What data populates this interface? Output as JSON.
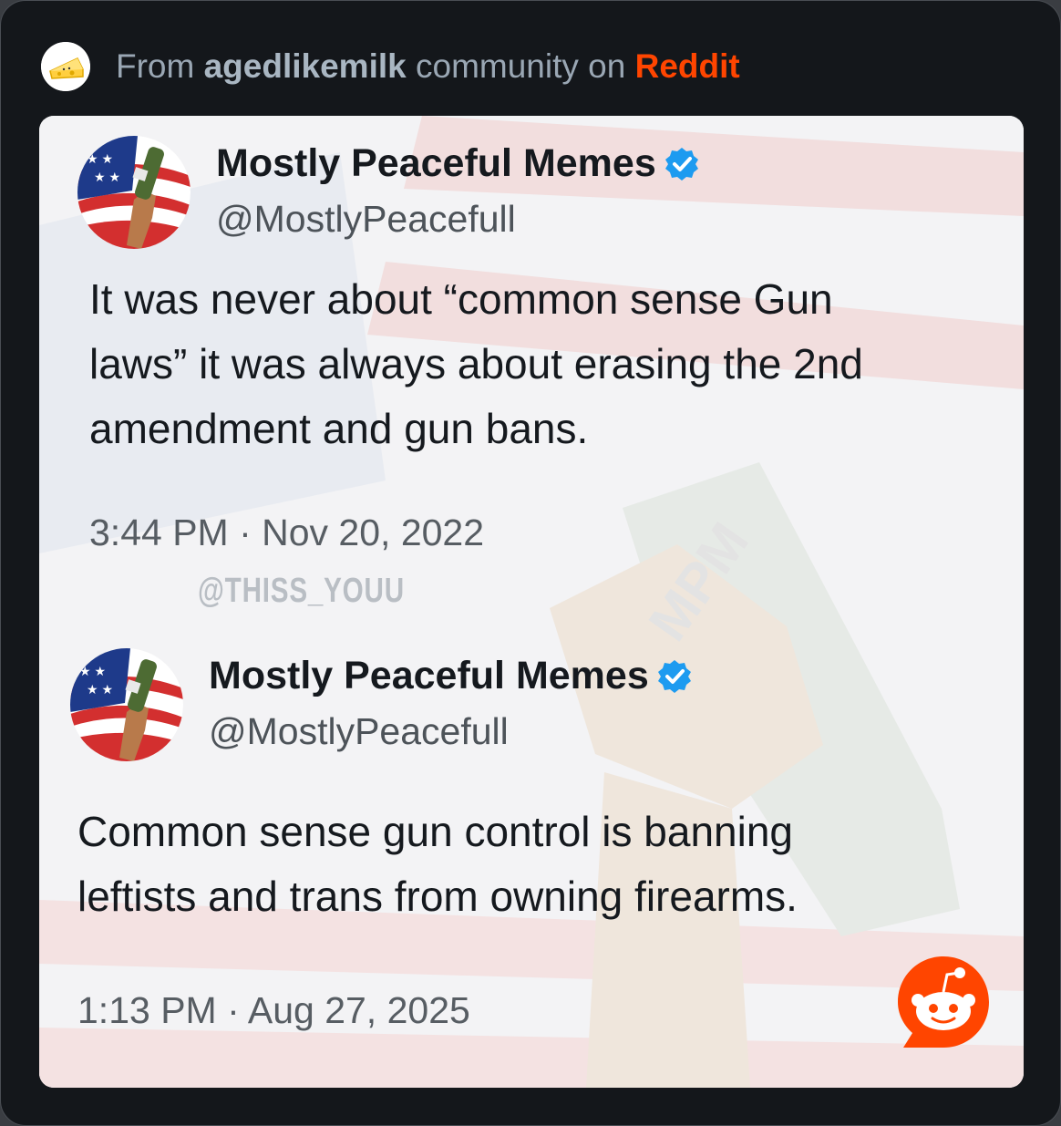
{
  "header": {
    "prefix": "From",
    "community": "agedlikemilk",
    "middle": "community on",
    "platform": "Reddit"
  },
  "tweets": [
    {
      "display_name": "Mostly Peaceful Memes",
      "handle": "@MostlyPeacefull",
      "text_lines": [
        "It was never about “common sense Gun",
        "laws” it was always about erasing the 2nd",
        "amendment and gun bans."
      ],
      "timestamp": "3:44 PM · Nov 20, 2022"
    },
    {
      "display_name": "Mostly Peaceful Memes",
      "handle": "@MostlyPeacefull",
      "text_lines": [
        "Common sense gun control is banning",
        "leftists and trans from owning firearms."
      ],
      "timestamp": "1:13 PM · Aug 27, 2025"
    }
  ],
  "watermark": "@THISS_YOUU",
  "colors": {
    "reddit_orange": "#ff4500",
    "verified_blue": "#1d9bf0"
  },
  "icons": [
    "cheese-avatar-icon",
    "verified-badge-icon",
    "reddit-logo-icon"
  ]
}
